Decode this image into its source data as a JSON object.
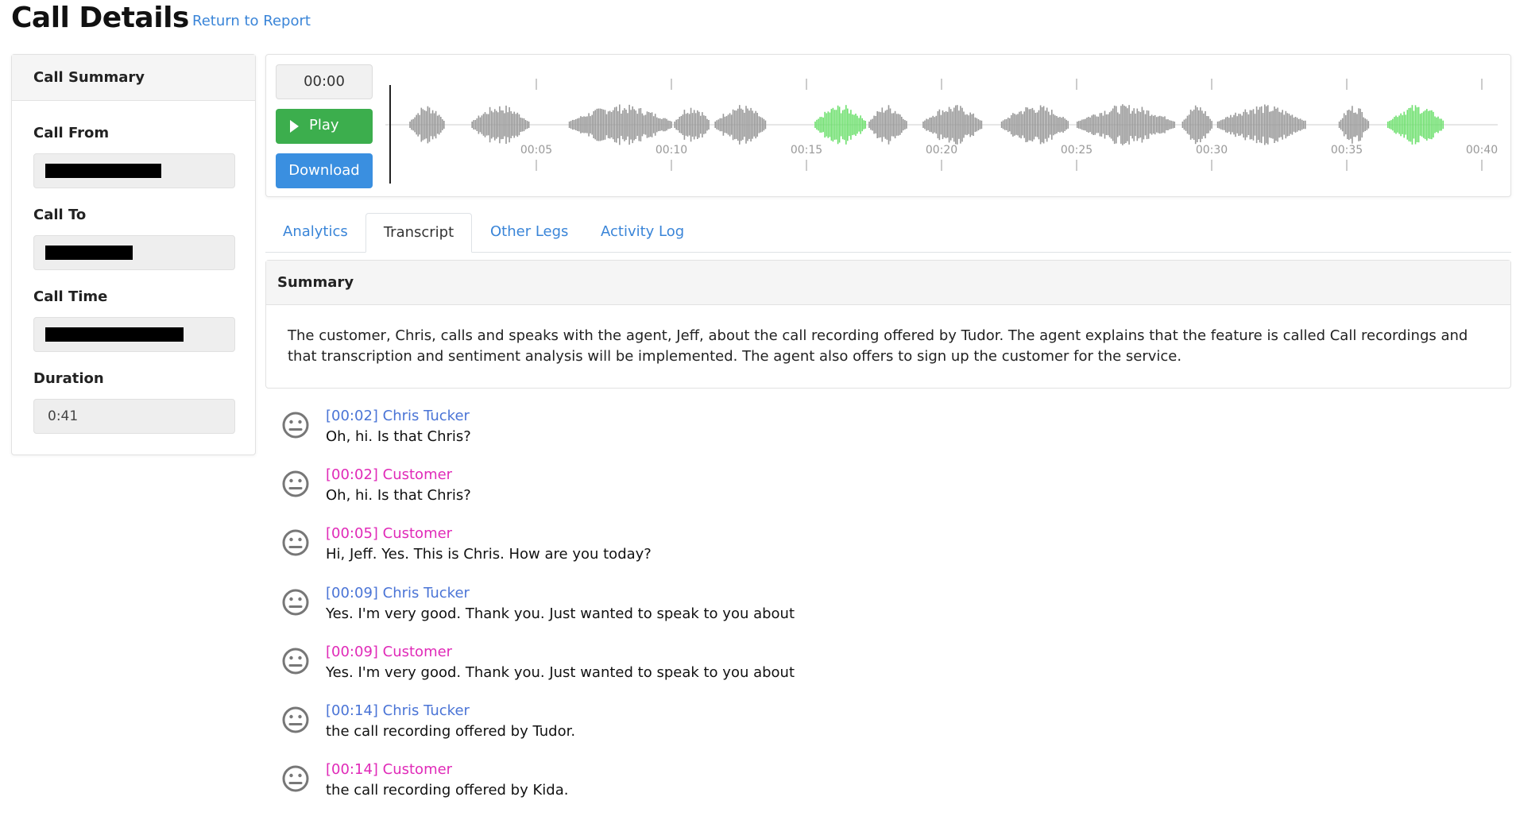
{
  "header": {
    "title": "Call Details",
    "return_link": "Return to Report"
  },
  "call_summary": {
    "title": "Call Summary",
    "fields": {
      "from_label": "Call From",
      "to_label": "Call To",
      "time_label": "Call Time",
      "duration_label": "Duration",
      "duration_value": "0:41"
    }
  },
  "player": {
    "current_time": "00:00",
    "play_label": "Play",
    "download_label": "Download",
    "timeline_ticks": [
      "00:05",
      "00:10",
      "00:15",
      "00:20",
      "00:25",
      "00:30",
      "00:35",
      "00:40"
    ],
    "colors": {
      "waveform": "#999999",
      "waveform_highlight": "#6fe06f",
      "cursor": "#222222"
    }
  },
  "tabs": [
    "Analytics",
    "Transcript",
    "Other Legs",
    "Activity Log"
  ],
  "active_tab": "Transcript",
  "summary": {
    "title": "Summary",
    "text": "The customer, Chris, calls and speaks with the agent, Jeff, about the call recording offered by Tudor. The agent explains that the feature is called Call recordings and that transcription and sentiment analysis will be implemented. The agent also offers to sign up the customer for the service."
  },
  "transcript": [
    {
      "speaker": "[00:02] Chris Tucker",
      "role": "agent",
      "text": "Oh, hi. Is that Chris?",
      "sentiment": "neutral-face-icon"
    },
    {
      "speaker": "[00:02] Customer",
      "role": "customer",
      "text": "Oh, hi. Is that Chris?",
      "sentiment": "neutral-face-icon"
    },
    {
      "speaker": "[00:05] Customer",
      "role": "customer",
      "text": "Hi, Jeff. Yes. This is Chris. How are you today?",
      "sentiment": "neutral-face-icon"
    },
    {
      "speaker": "[00:09] Chris Tucker",
      "role": "agent",
      "text": "Yes. I'm very good. Thank you. Just wanted to speak to you about",
      "sentiment": "neutral-face-icon"
    },
    {
      "speaker": "[00:09] Customer",
      "role": "customer",
      "text": "Yes. I'm very good. Thank you. Just wanted to speak to you about",
      "sentiment": "neutral-face-icon"
    },
    {
      "speaker": "[00:14] Chris Tucker",
      "role": "agent",
      "text": "the call recording offered by Tudor.",
      "sentiment": "neutral-face-icon"
    },
    {
      "speaker": "[00:14] Customer",
      "role": "customer",
      "text": "the call recording offered by Kida.",
      "sentiment": "neutral-face-icon"
    }
  ]
}
